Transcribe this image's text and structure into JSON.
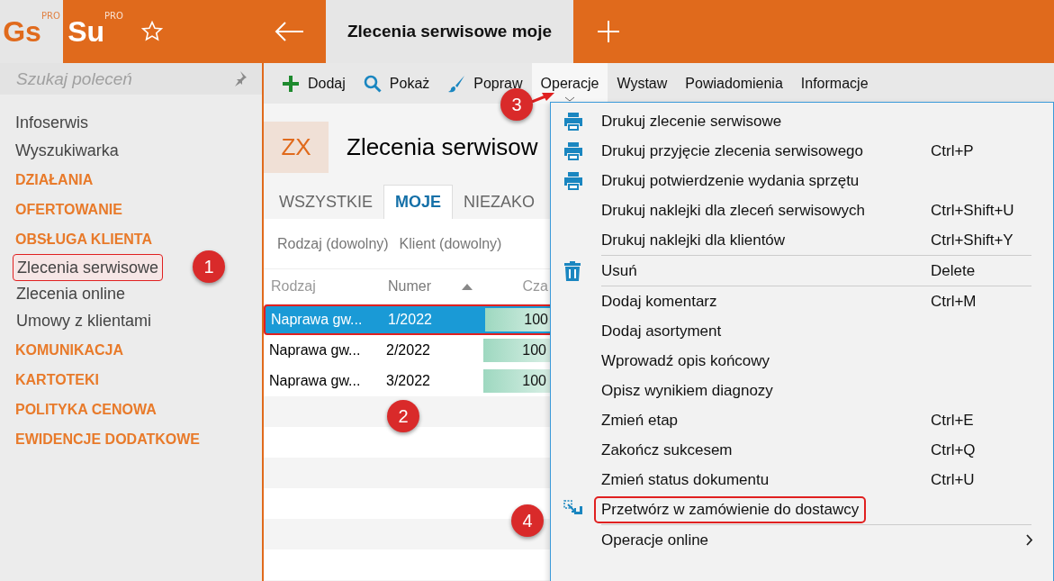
{
  "top_bar": {
    "logos": [
      {
        "text": "Gs",
        "sup": "PRO",
        "active": false
      },
      {
        "text": "Su",
        "sup": "PRO",
        "active": true
      }
    ],
    "tab_title": "Zlecenia serwisowe moje"
  },
  "sidebar": {
    "search": {
      "placeholder": "Szukaj poleceń"
    },
    "items": [
      {
        "label": "Infoserwis",
        "kind": "link",
        "selected": false
      },
      {
        "label": "Wyszukiwarka",
        "kind": "link",
        "selected": false
      },
      {
        "label": "DZIAŁANIA",
        "kind": "section",
        "selected": false
      },
      {
        "label": "OFERTOWANIE",
        "kind": "section",
        "selected": false
      },
      {
        "label": "OBSŁUGA KLIENTA",
        "kind": "section",
        "selected": false,
        "children": [
          {
            "label": "Zlecenia serwisowe",
            "kind": "link",
            "selected": true
          },
          {
            "label": "Zlecenia online",
            "kind": "link",
            "selected": false
          },
          {
            "label": "Umowy z klientami",
            "kind": "link",
            "selected": false
          }
        ]
      },
      {
        "label": "KOMUNIKACJA",
        "kind": "section",
        "selected": false
      },
      {
        "label": "KARTOTEKI",
        "kind": "section",
        "selected": false
      },
      {
        "label": "POLITYKA CENOWA",
        "kind": "section",
        "selected": false
      },
      {
        "label": "EWIDENCJE DODATKOWE",
        "kind": "section",
        "selected": false
      }
    ]
  },
  "toolbar": [
    {
      "label": "Dodaj",
      "kind": "add",
      "selected": false
    },
    {
      "label": "Pokaż",
      "kind": "show",
      "selected": false
    },
    {
      "label": "Popraw",
      "kind": "edit",
      "selected": false
    },
    {
      "label": "Operacje",
      "kind": "menu",
      "selected": true
    },
    {
      "label": "Wystaw",
      "kind": "menu",
      "selected": false
    },
    {
      "label": "Powiadomienia",
      "kind": "menu",
      "selected": false
    },
    {
      "label": "Informacje",
      "kind": "menu",
      "selected": false
    }
  ],
  "header": {
    "badge": "ZX",
    "title": "Zlecenia serwisow"
  },
  "tabs": [
    {
      "label": "WSZYSTKIE",
      "selected": false
    },
    {
      "label": "MOJE",
      "selected": true
    },
    {
      "label": "NIEZAKO",
      "selected": false
    }
  ],
  "filters": [
    "Rodzaj (dowolny)",
    "Klient (dowolny)"
  ],
  "table": {
    "columns": [
      {
        "label": "Rodzaj",
        "sorted": false
      },
      {
        "label": "Numer",
        "sorted": true
      },
      {
        "label": "Cza",
        "sorted": false
      }
    ],
    "rows": [
      {
        "cells": [
          "Naprawa gw...",
          "1/2022"
        ],
        "value": "100",
        "level": 1,
        "selected": true
      },
      {
        "cells": [
          "Naprawa gw...",
          "2/2022"
        ],
        "value": "100",
        "level": 1,
        "selected": false
      },
      {
        "cells": [
          "Naprawa gw...",
          "3/2022"
        ],
        "value": "100",
        "level": 1,
        "selected": false
      }
    ]
  },
  "menu": {
    "groups": [
      [
        {
          "label": "Drukuj zlecenie serwisowe",
          "kind": "print"
        },
        {
          "label": "Drukuj przyjęcie zlecenia serwisowego",
          "kind": "print",
          "shortcut": "Ctrl+P"
        },
        {
          "label": "Drukuj potwierdzenie wydania sprzętu",
          "kind": "print"
        },
        {
          "label": "Drukuj naklejki dla zleceń serwisowych",
          "kind": "plain",
          "shortcut": "Ctrl+Shift+U"
        },
        {
          "label": "Drukuj naklejki dla klientów",
          "kind": "plain",
          "shortcut": "Ctrl+Shift+Y"
        }
      ],
      [
        {
          "label": "Usuń",
          "kind": "delete",
          "shortcut": "Delete"
        }
      ],
      [
        {
          "label": "Dodaj komentarz",
          "kind": "plain",
          "shortcut": "Ctrl+M"
        },
        {
          "label": "Dodaj asortyment",
          "kind": "plain"
        },
        {
          "label": "Wprowadź opis końcowy",
          "kind": "plain"
        },
        {
          "label": "Opisz wynikiem diagnozy",
          "kind": "plain"
        },
        {
          "label": "Zmień etap",
          "kind": "plain",
          "shortcut": "Ctrl+E"
        },
        {
          "label": "Zakończ sukcesem",
          "kind": "plain",
          "shortcut": "Ctrl+Q"
        },
        {
          "label": "Zmień status dokumentu",
          "kind": "plain",
          "shortcut": "Ctrl+U"
        },
        {
          "label": "Przetwórz w zamówienie do dostawcy",
          "kind": "convert",
          "highlighted": true
        }
      ],
      [
        {
          "label": "Operacje online",
          "kind": "plain",
          "submenu": true
        }
      ]
    ]
  },
  "callouts": [
    "1",
    "2",
    "3",
    "4"
  ]
}
